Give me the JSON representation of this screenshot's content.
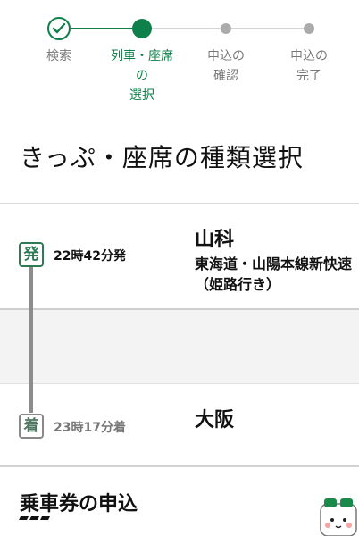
{
  "stepper": {
    "steps": [
      {
        "label": "検索",
        "state": "done"
      },
      {
        "label": "列車・座席\nの\n選択",
        "state": "current"
      },
      {
        "label": "申込の\n確認",
        "state": "pending"
      },
      {
        "label": "申込の\n完了",
        "state": "pending"
      }
    ]
  },
  "page": {
    "title": "きっぷ・座席の種類選択"
  },
  "train": {
    "departure": {
      "badge": "発",
      "time": "22時42分発",
      "station": "山科"
    },
    "train_name": "東海道・山陽本線新快速（姫路行き）",
    "arrival": {
      "badge": "着",
      "time": "23時17分着",
      "station": "大阪"
    }
  },
  "section": {
    "title": "乗車券の申込"
  },
  "icons": {
    "done_step": "check-icon",
    "mascot": "mascot-icon"
  },
  "colors": {
    "accent": "#0f8049",
    "pending": "#ababab",
    "timeline": "#8c8c8c"
  }
}
